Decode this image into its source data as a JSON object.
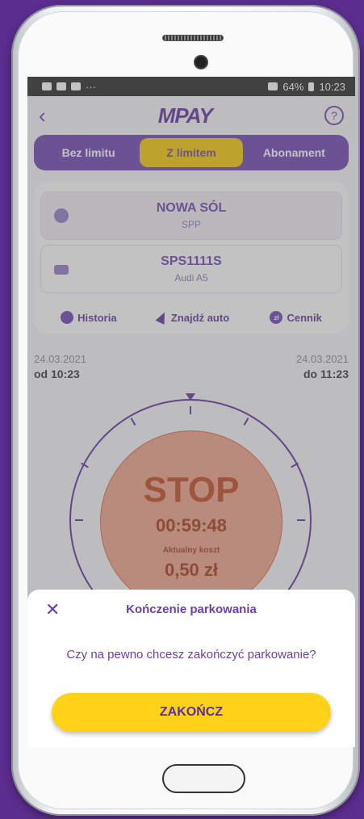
{
  "statusbar": {
    "more": "···",
    "battery": "64%",
    "time": "10:23"
  },
  "header": {
    "back": "‹",
    "logo": "MPAY",
    "help": "?"
  },
  "tabs": [
    {
      "label": "Bez limitu"
    },
    {
      "label": "Z limitem"
    },
    {
      "label": "Abonament"
    }
  ],
  "zone": {
    "city": "NOWA SÓL",
    "code": "SPP"
  },
  "vehicle": {
    "plate": "SPS1111S",
    "model": "Audi A5"
  },
  "actions": {
    "history": "Historia",
    "find_car": "Znajdź auto",
    "price_icon": "zł",
    "price": "Cennik"
  },
  "session": {
    "start_date": "24.03.2021",
    "start_time": "od 10:23",
    "end_date": "24.03.2021",
    "end_time": "do 11:23",
    "stop_label": "STOP",
    "timer": "00:59:48",
    "cost_label": "Aktualny koszt",
    "cost": "0,50 zł"
  },
  "sheet": {
    "close": "✕",
    "title": "Kończenie parkowania",
    "message": "Czy na pewno chcesz zakończyć parkowanie?",
    "confirm": "ZAKOŃCZ"
  },
  "colors": {
    "brand": "#6a3fb0",
    "accent": "#ffd21a",
    "background": "#5b2d8e"
  }
}
